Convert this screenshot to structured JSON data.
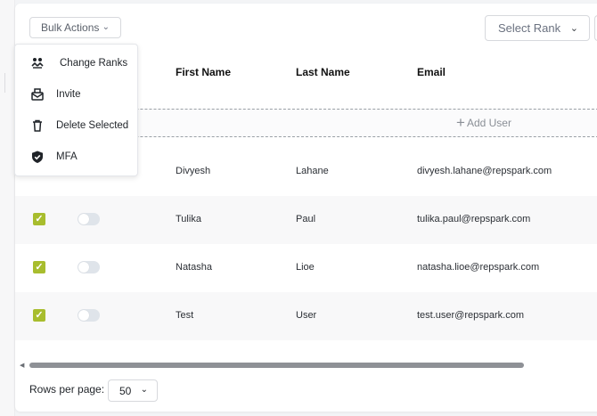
{
  "toolbar": {
    "bulk_actions_label": "Bulk Actions",
    "select_rank_placeholder": "Select Rank"
  },
  "bulk_menu": {
    "items": [
      {
        "label": "Change Ranks",
        "icon": "change-ranks-icon"
      },
      {
        "label": "Invite",
        "icon": "invite-icon"
      },
      {
        "label": "Delete Selected",
        "icon": "trash-icon"
      },
      {
        "label": "MFA",
        "icon": "shield-check-icon"
      }
    ]
  },
  "table": {
    "columns": [
      "First Name",
      "Last Name",
      "Email"
    ],
    "add_user_label": "Add User",
    "rows": [
      {
        "first_name": "Divyesh",
        "last_name": "Lahane",
        "email": "divyesh.lahane@repspark.com",
        "checked": false
      },
      {
        "first_name": "Tulika",
        "last_name": "Paul",
        "email": "tulika.paul@repspark.com",
        "checked": true
      },
      {
        "first_name": "Natasha",
        "last_name": "Lioe",
        "email": "natasha.lioe@repspark.com",
        "checked": true
      },
      {
        "first_name": "Test",
        "last_name": "User",
        "email": "test.user@repspark.com",
        "checked": true
      }
    ]
  },
  "pagination": {
    "rows_per_page_label": "Rows per page:",
    "rows_per_page_value": "50"
  },
  "colors": {
    "checkbox": "#a8bd2e",
    "toggle_off": "#dfe4ea",
    "scroll_thumb": "#8e9196"
  }
}
